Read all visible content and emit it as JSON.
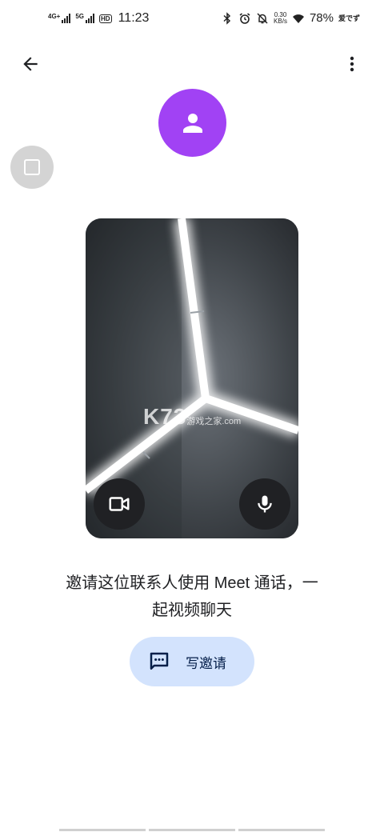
{
  "status_bar": {
    "net1_label": "4G+",
    "net2_label": "5G",
    "hd_label": "HD",
    "time": "11:23",
    "net_speed_value": "0.30",
    "net_speed_unit": "KB/s",
    "battery": "78%",
    "carrier_logo": "爱でず"
  },
  "top_bar": {
    "back_icon": "arrow-back-icon",
    "more_icon": "more-vert-icon"
  },
  "contact": {
    "avatar_icon": "person-icon",
    "avatar_color": "#a142f4"
  },
  "preview": {
    "camera_icon": "videocam-icon",
    "mic_icon": "mic-icon",
    "watermark_main": "K73",
    "watermark_sub": "游戏之家",
    "watermark_domain": ".com"
  },
  "invite": {
    "message_line1": "邀请这位联系人使用 Meet 通话，一",
    "message_line2": "起视频聊天",
    "button_label": "写邀请",
    "button_icon": "chat-icon",
    "button_color": "#d3e3fd"
  }
}
